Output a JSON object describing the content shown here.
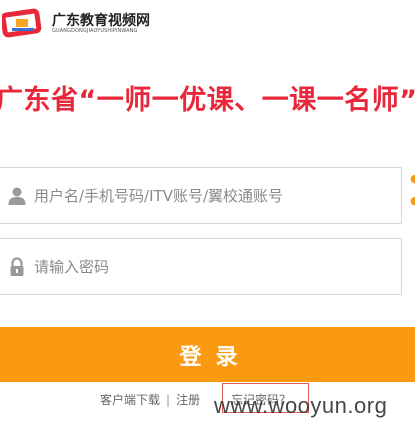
{
  "brand": {
    "name": "广东教育视频网",
    "sub": "GUANGDONGJIAOYUSHIPINWANG",
    "logo_color": "#e8283a"
  },
  "banner": {
    "text": "广东省“一师一优课、一课一名师”"
  },
  "form": {
    "username_placeholder": "用户名/手机号码/ITV账号/翼校通账号",
    "password_placeholder": "请输入密码",
    "login_label": "登录"
  },
  "links": {
    "download": "客户端下载",
    "separator": "|",
    "register": "注册",
    "forgot": "忘记密码？"
  },
  "watermark": "www.wooyun.org",
  "colors": {
    "accent": "#fb9a10",
    "banner": "#e8283a"
  }
}
